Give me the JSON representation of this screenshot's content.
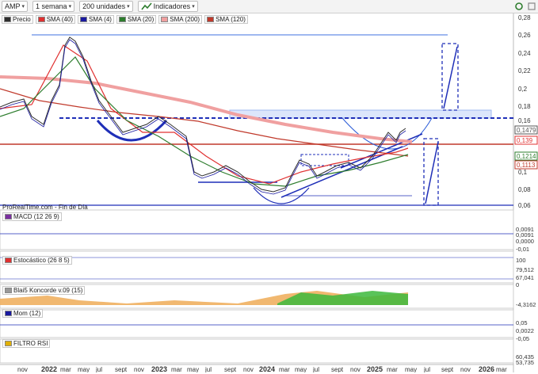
{
  "toolbar": {
    "ticker": "AMP",
    "period": "1 semana",
    "units": "200 unidades",
    "indicators": "Indicadores"
  },
  "legend": [
    {
      "label": "Precio",
      "color": "#2e2e2e"
    },
    {
      "label": "SMA (40)",
      "color": "#e03030"
    },
    {
      "label": "SMA (4)",
      "color": "#1a1aa0"
    },
    {
      "label": "SMA (20)",
      "color": "#2e7d2e"
    },
    {
      "label": "SMA (200)",
      "color": "#f0a0a0"
    },
    {
      "label": "SMA (120)",
      "color": "#c0392b"
    }
  ],
  "price_axis": [
    "0,28",
    "0,26",
    "0,24",
    "0,22",
    "0,2",
    "0,18",
    "0,16",
    "0,1",
    "0,08",
    "0,06"
  ],
  "price_tags": [
    {
      "text": "0,1479",
      "color": "#555"
    },
    {
      "text": "0,139",
      "color": "#e03030"
    },
    {
      "text": "0,1214",
      "color": "#2e7d2e"
    },
    {
      "text": "0,1113",
      "color": "#c0392b"
    }
  ],
  "source": "ProRealTime.com - Fin de Día",
  "panels": [
    {
      "label": "MACD (12 26 9)",
      "values": [
        "0,0091",
        "0,0091",
        "0,0000",
        "-0,01"
      ]
    },
    {
      "label": "Estocástico (26 8 5)",
      "values": [
        "100",
        "79,512",
        "67,041",
        "0"
      ]
    },
    {
      "label": "Blai5 Koncorde v.09 (15)",
      "values": [
        "-4,3162"
      ]
    },
    {
      "label": "Mom (12)",
      "values": [
        "0,05",
        "0,0022",
        "-0,05"
      ]
    },
    {
      "label": "FILTRO RSI",
      "values": [
        "60,435",
        "53,735"
      ]
    }
  ],
  "x_axis": [
    "nov",
    "2022",
    "mar",
    "may",
    "jul",
    "sept",
    "nov",
    "2023",
    "mar",
    "may",
    "jul",
    "sept",
    "nov",
    "2024",
    "mar",
    "may",
    "jul",
    "sept",
    "nov",
    "2025",
    "mar",
    "may",
    "jul",
    "sept",
    "nov",
    "2026",
    "mar"
  ],
  "colors": {
    "price": "#2e2e2e",
    "sma40": "#e03030",
    "sma4": "#1a1aa0",
    "sma20": "#2e7d2e",
    "sma200": "#f0a0a0",
    "sma120": "#c0392b",
    "trend": "#1f2fb8",
    "accent_blue": "#2a5bd7"
  }
}
